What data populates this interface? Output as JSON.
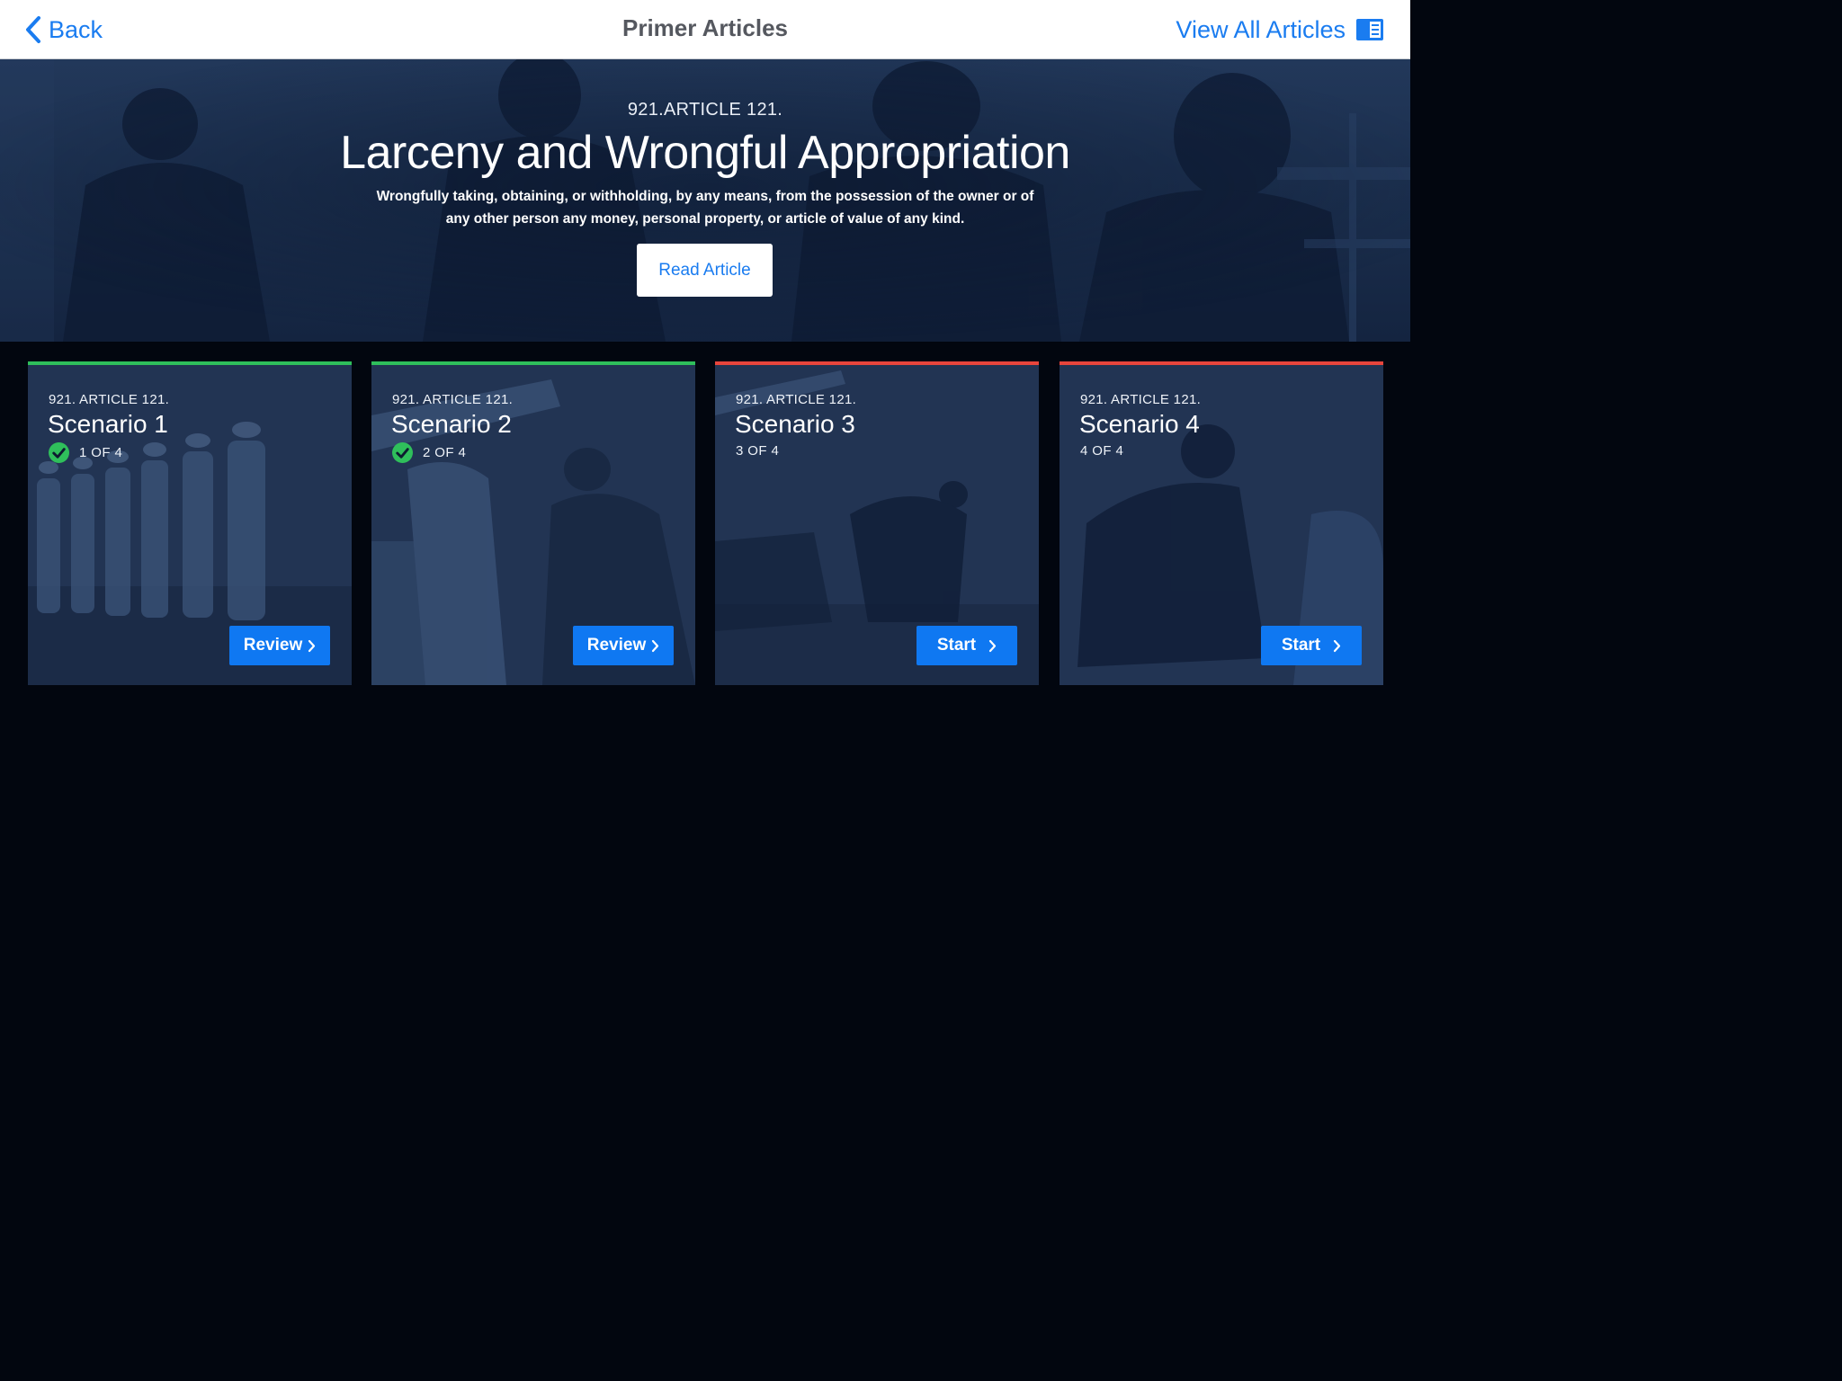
{
  "nav": {
    "back_label": "Back",
    "title": "Primer Articles",
    "view_all_label": "View All Articles",
    "accent": "#1a7cf0"
  },
  "hero": {
    "article": "921.ARTICLE 121.",
    "title": "Larceny and Wrongful Appropriation",
    "description": "Wrongfully taking, obtaining, or withholding, by any means, from the possession of the owner or of any other person any money, personal property, or article of value of any kind.",
    "button_label": "Read Article"
  },
  "scenarios": [
    {
      "article": "921. ARTICLE 121.",
      "title": "Scenario 1",
      "progress": "1 OF 4",
      "completed": true,
      "status_color": "#2fbf5b",
      "button_label": "Review",
      "icon": "check-circle-icon"
    },
    {
      "article": "921. ARTICLE 121.",
      "title": "Scenario 2",
      "progress": "2 OF 4",
      "completed": true,
      "status_color": "#2fbf5b",
      "button_label": "Review",
      "icon": "check-circle-icon"
    },
    {
      "article": "921. ARTICLE 121.",
      "title": "Scenario 3",
      "progress": "3 OF 4",
      "completed": false,
      "status_color": "#e8453c",
      "button_label": "Start"
    },
    {
      "article": "921. ARTICLE 121.",
      "title": "Scenario 4",
      "progress": "4 OF 4",
      "completed": false,
      "status_color": "#e8453c",
      "button_label": "Start"
    }
  ],
  "colors": {
    "background": "#02060f",
    "button_blue": "#0f78f2",
    "complete_green": "#2fbf5b",
    "incomplete_red": "#e8453c"
  }
}
